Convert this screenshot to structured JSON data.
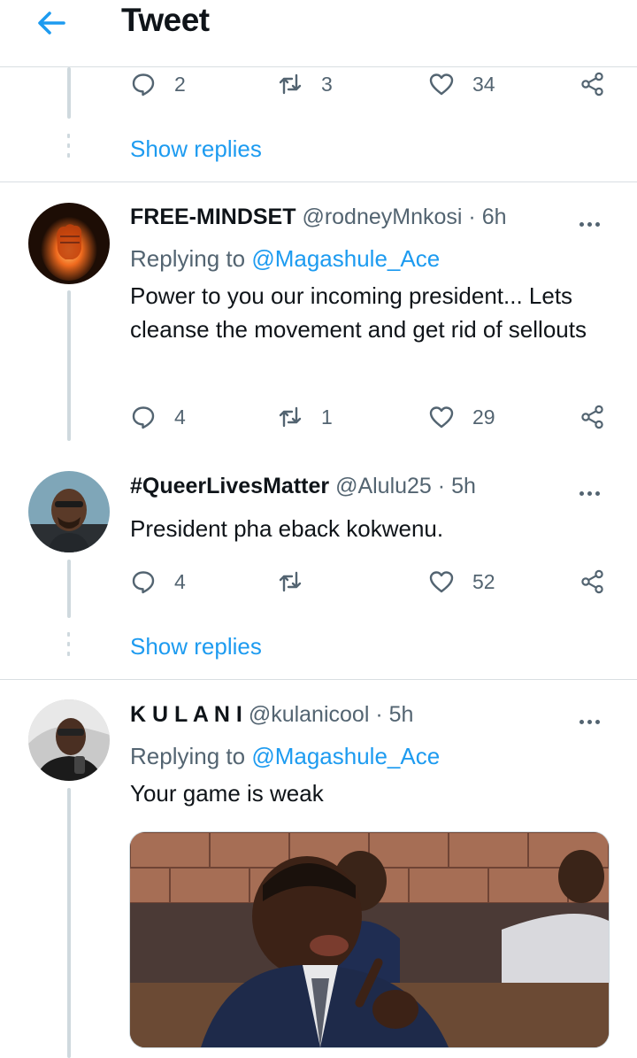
{
  "header": {
    "title": "Tweet",
    "back_icon": "arrow-left-icon",
    "accent": "#1d9bf0"
  },
  "top_tweet": {
    "actions": {
      "replies": "2",
      "retweets": "3",
      "likes": "34"
    },
    "show_replies": "Show replies"
  },
  "tweets": [
    {
      "name": "FREE-MINDSET",
      "handle": "@rodneyMnkosi",
      "dot": "·",
      "time": "6h",
      "replying_label": "Replying to",
      "replying_to": "@Magashule_Ace",
      "text": "Power to you our incoming president... Lets cleanse the movement and get rid of sellouts",
      "actions": {
        "replies": "4",
        "retweets": "1",
        "likes": "29"
      }
    },
    {
      "name": "#QueerLivesMatter",
      "handle": "@Alulu25",
      "dot": "·",
      "time": "5h",
      "text": "President pha eback kokwenu.",
      "actions": {
        "replies": "4",
        "retweets": "",
        "likes": "52"
      },
      "show_replies": "Show replies"
    },
    {
      "name": "K U L A N I",
      "handle": "@kulanicool",
      "dot": "·",
      "time": "5h",
      "replying_label": "Replying to",
      "replying_to": "@Magashule_Ace",
      "text": "Your game is weak"
    }
  ],
  "icons": [
    "reply-icon",
    "retweet-icon",
    "like-icon",
    "share-icon",
    "more-icon"
  ]
}
